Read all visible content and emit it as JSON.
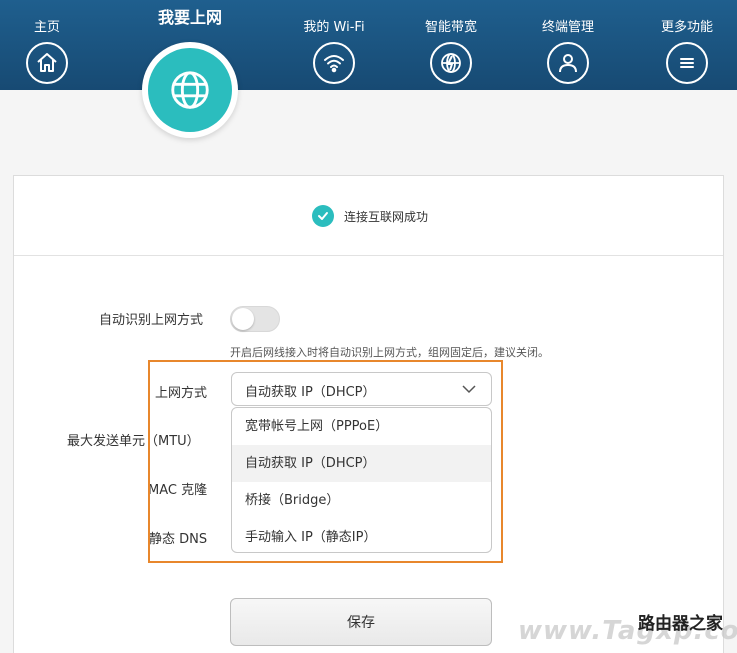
{
  "nav": {
    "home": "主页",
    "internet": "我要上网",
    "wifi": "我的 Wi-Fi",
    "bandwidth": "智能带宽",
    "devices": "终端管理",
    "more": "更多功能"
  },
  "status": {
    "text": "连接互联网成功"
  },
  "form": {
    "auto_detect_label": "自动识别上网方式",
    "auto_detect_hint": "开启后网线接入时将自动识别上网方式，组网固定后，建议关闭。",
    "auto_detect_on": false,
    "mode_label": "上网方式",
    "mode_value": "自动获取 IP（DHCP）",
    "mtu_label": "最大发送单元（MTU）",
    "mac_label": "MAC 克隆",
    "dns_label": "静态 DNS",
    "options": [
      "宽带帐号上网（PPPoE）",
      "自动获取 IP（DHCP）",
      "桥接（Bridge）",
      "手动输入 IP（静态IP）"
    ],
    "save_label": "保存"
  },
  "watermark": {
    "title": "路由器之家",
    "url": "www.Tagxp.com"
  },
  "colors": {
    "nav_bg": "#1f5f8e",
    "accent": "#2bbdbe",
    "highlight": "#e8872c"
  }
}
